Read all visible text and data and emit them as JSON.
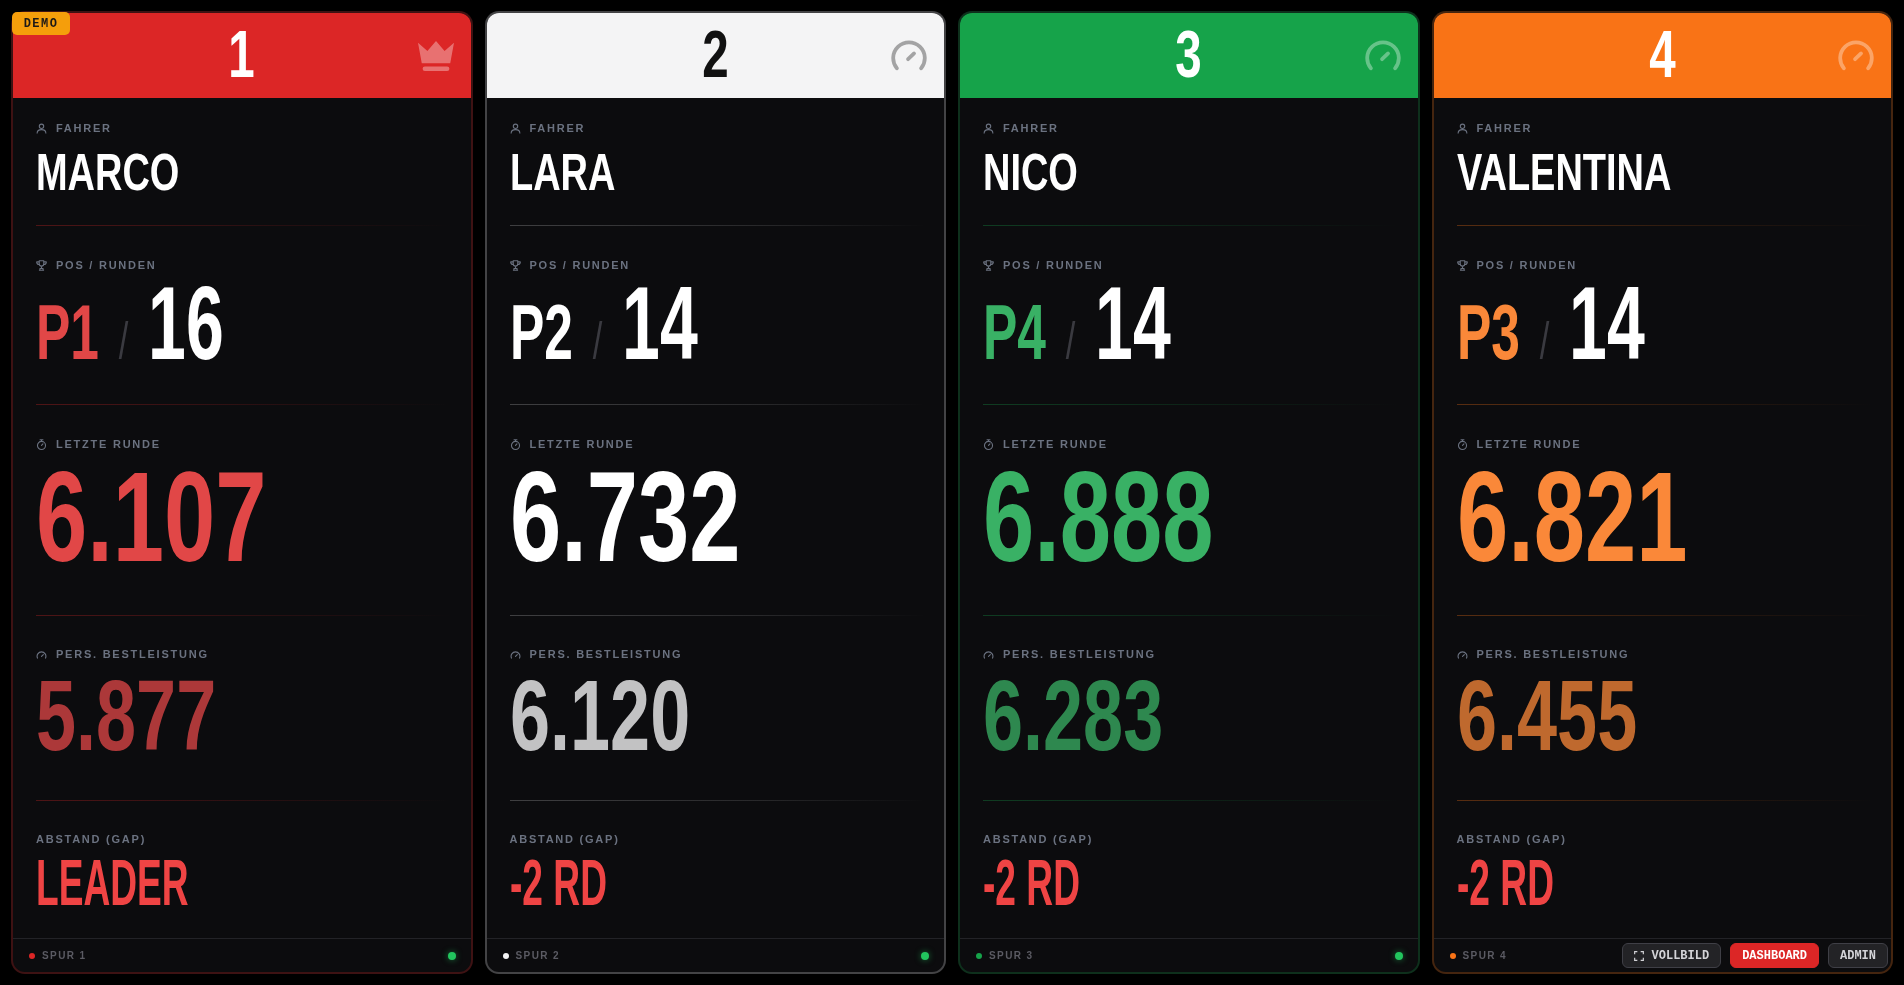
{
  "badge": "DEMO",
  "lanes": [
    {
      "number": "1",
      "color": "#dc2626",
      "leader": true,
      "driver_label": "FAHRER",
      "driver": "MARCO",
      "pos_label": "POS / RUNDEN",
      "position": "P1",
      "separator": "/",
      "laps": "16",
      "last_lap_label": "LETZTE RUNDE",
      "last_lap": "6.107",
      "best_label": "PERS. BESTLEISTUNG",
      "best": "5.877",
      "gap_label": "ABSTAND (GAP)",
      "gap": "LEADER",
      "lane": "SPUR 1",
      "online": true
    },
    {
      "number": "2",
      "color": "#f4f4f5",
      "leader": false,
      "driver_label": "FAHRER",
      "driver": "LARA",
      "pos_label": "POS / RUNDEN",
      "position": "P2",
      "separator": "/",
      "laps": "14",
      "last_lap_label": "LETZTE RUNDE",
      "last_lap": "6.732",
      "best_label": "PERS. BESTLEISTUNG",
      "best": "6.120",
      "gap_label": "ABSTAND (GAP)",
      "gap": "-2 RD",
      "lane": "SPUR 2",
      "online": true
    },
    {
      "number": "3",
      "color": "#16a34a",
      "leader": false,
      "driver_label": "FAHRER",
      "driver": "NICO",
      "pos_label": "POS / RUNDEN",
      "position": "P4",
      "separator": "/",
      "laps": "14",
      "last_lap_label": "LETZTE RUNDE",
      "last_lap": "6.888",
      "best_label": "PERS. BESTLEISTUNG",
      "best": "6.283",
      "gap_label": "ABSTAND (GAP)",
      "gap": "-2 RD",
      "lane": "SPUR 3",
      "online": true
    },
    {
      "number": "4",
      "color": "#f97316",
      "leader": false,
      "driver_label": "FAHRER",
      "driver": "VALENTINA",
      "pos_label": "POS / RUNDEN",
      "position": "P3",
      "separator": "/",
      "laps": "14",
      "last_lap_label": "LETZTE RUNDE",
      "last_lap": "6.821",
      "best_label": "PERS. BESTLEISTUNG",
      "best": "6.455",
      "gap_label": "ABSTAND (GAP)",
      "gap": "-2 RD",
      "lane": "SPUR 4"
    }
  ],
  "buttons": [
    {
      "label": "VOLLBILD",
      "kind": "fullscreen",
      "selected": false
    },
    {
      "label": "DASHBOARD",
      "kind": "link",
      "selected": true
    },
    {
      "label": "ADMIN",
      "kind": "link",
      "selected": false
    }
  ]
}
